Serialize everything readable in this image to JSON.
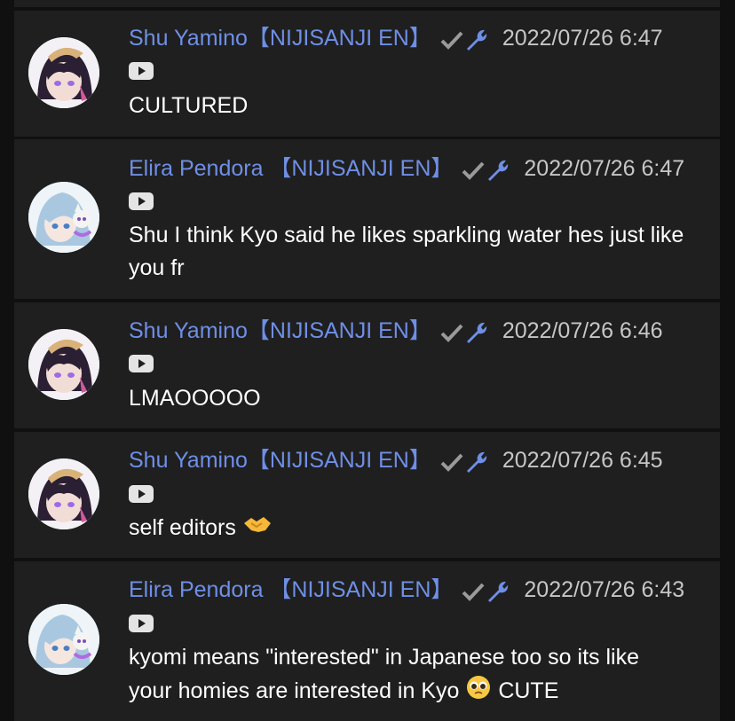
{
  "colors": {
    "background": "#101010",
    "card": "#1f1f1f",
    "author": "#6f8fe6",
    "verified_check": "#9a9a9a",
    "wrench": "#6f8fe6",
    "timestamp": "#c6c6c6",
    "text": "#ffffff"
  },
  "comments": [
    {
      "author": "Shu Yamino【NIJISANJI EN】",
      "timestamp": "2022/07/26 6:47",
      "platform_icon": "youtube-icon",
      "text": "CULTURED",
      "avatar": "shu-avatar"
    },
    {
      "author": "Elira Pendora 【NIJISANJI EN】",
      "timestamp": "2022/07/26 6:47",
      "platform_icon": "youtube-icon",
      "text_lines": [
        "Shu I think Kyo said he likes sparkling water hes just like",
        "you fr"
      ],
      "avatar": "elira-avatar"
    },
    {
      "author": "Shu Yamino【NIJISANJI EN】",
      "timestamp": "2022/07/26 6:46",
      "platform_icon": "youtube-icon",
      "text": "LMAOOOOO",
      "avatar": "shu-avatar"
    },
    {
      "author": "Shu Yamino【NIJISANJI EN】",
      "timestamp": "2022/07/26 6:45",
      "platform_icon": "youtube-icon",
      "text": "self editors",
      "emoji": "handshake-emoji",
      "avatar": "shu-avatar"
    },
    {
      "author": "Elira Pendora 【NIJISANJI EN】",
      "timestamp": "2022/07/26 6:43",
      "platform_icon": "youtube-icon",
      "text_lines": [
        "kyomi means \"interested\" in Japanese too so its like",
        "your homies are interested in Kyo"
      ],
      "emoji": "pleading-face-emoji",
      "text_after_emoji": "CUTE",
      "avatar": "elira-avatar"
    }
  ]
}
